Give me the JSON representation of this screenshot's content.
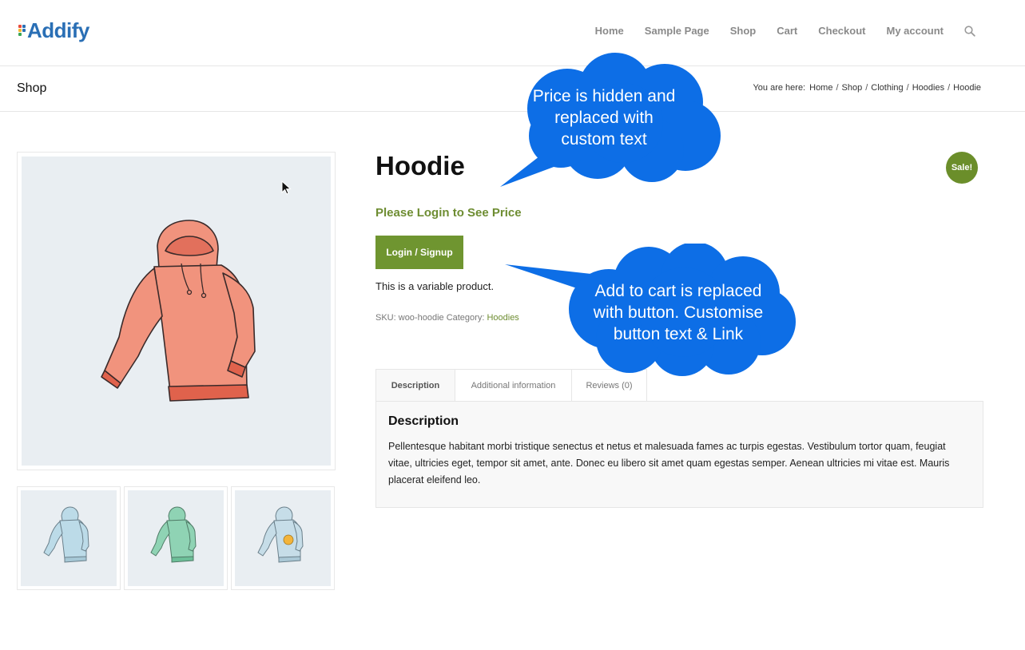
{
  "brand": {
    "logo_text": "Addify"
  },
  "nav": {
    "items": [
      "Home",
      "Sample Page",
      "Shop",
      "Cart",
      "Checkout",
      "My account"
    ]
  },
  "titlebar": {
    "title": "Shop",
    "breadcrumb_prefix": "You are here:",
    "crumbs": [
      "Home",
      "Shop",
      "Clothing",
      "Hoodies",
      "Hoodie"
    ],
    "separator": "/"
  },
  "product": {
    "title": "Hoodie",
    "sale_badge": "Sale!",
    "price_text": "Please Login to See Price",
    "button_label": "Login / Signup",
    "short_description": "This is a variable product.",
    "sku_label": "SKU:",
    "sku": "woo-hoodie",
    "category_label": "Category:",
    "category": "Hoodies"
  },
  "tabs": {
    "items": [
      "Description",
      "Additional information",
      "Reviews (0)"
    ],
    "active": "Description",
    "panel_heading": "Description",
    "panel_text": "Pellentesque habitant morbi tristique senectus et netus et malesuada fames ac turpis egestas. Vestibulum tortor quam, feugiat vitae, ultricies eget, tempor sit amet, ante. Donec eu libero sit amet quam egestas semper. Aenean ultricies mi vitae est. Mauris placerat eleifend leo."
  },
  "callouts": {
    "price": {
      "lines": [
        "Price is hidden and",
        "replaced with",
        "custom text"
      ]
    },
    "button": {
      "lines": [
        "Add to cart is replaced",
        "with button. Customise",
        "button text & Link"
      ]
    }
  },
  "colors": {
    "accent_green": "#6f9530",
    "callout_blue": "#0d6ee6",
    "logo_blue": "#2a6fb5",
    "hoodie_main": "#f0907c",
    "hoodie_blue": "#bcdbe8",
    "hoodie_green": "#8fd3b4"
  },
  "icons": {
    "search": "search-icon",
    "cursor": "mouse-cursor-icon"
  }
}
